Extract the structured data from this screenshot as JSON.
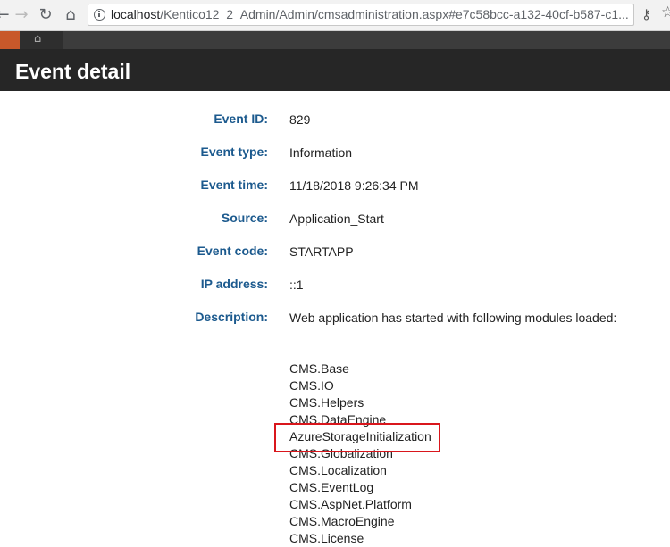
{
  "browser": {
    "back_icon": "back-arrow-icon",
    "forward_icon": "forward-arrow-icon",
    "reload_icon": "reload-icon",
    "home_icon": "home-icon",
    "url_host": "localhost",
    "url_path": "/Kentico12_2_Admin/Admin/cmsadministration.aspx#e7c58bcc-a132-40cf-b587-c1..."
  },
  "header": {
    "title": "Event detail"
  },
  "fields": [
    {
      "label": "Event ID:",
      "value": "829"
    },
    {
      "label": "Event type:",
      "value": "Information"
    },
    {
      "label": "Event time:",
      "value": "11/18/2018 9:26:34 PM"
    },
    {
      "label": "Source:",
      "value": "Application_Start"
    },
    {
      "label": "Event code:",
      "value": "STARTAPP"
    },
    {
      "label": "IP address:",
      "value": "::1"
    },
    {
      "label": "Description:",
      "value": "Web application has started with following modules loaded:"
    }
  ],
  "modules": [
    "CMS.Base",
    "CMS.IO",
    "CMS.Helpers",
    "CMS.DataEngine",
    "AzureStorageInitialization",
    "CMS.Globalization",
    "CMS.Localization",
    "CMS.EventLog",
    "CMS.AspNet.Platform",
    "CMS.MacroEngine",
    "CMS.License"
  ],
  "highlighted_module": "AzureStorageInitialization",
  "highlight_color": "#d9161c"
}
